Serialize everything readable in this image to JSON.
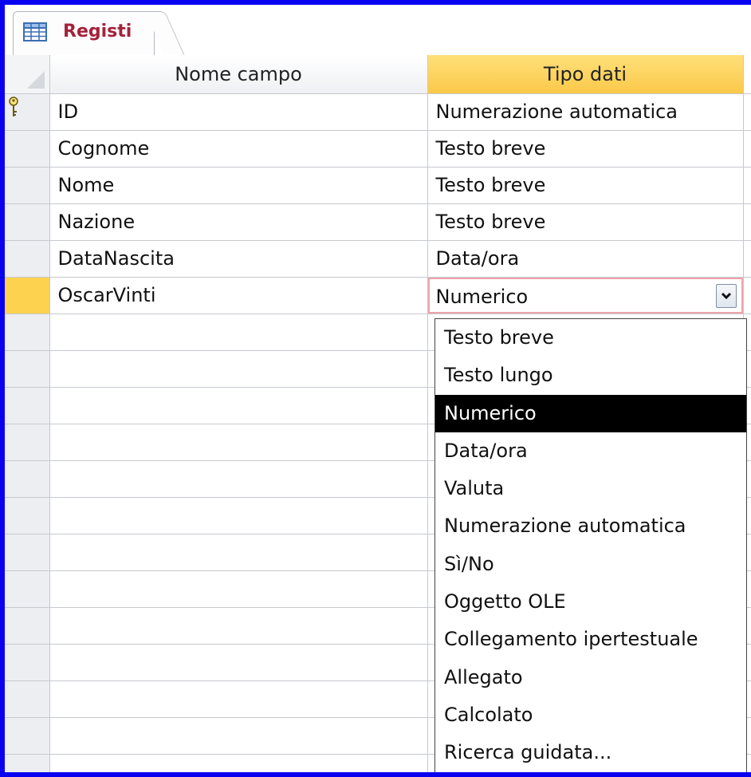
{
  "tab": {
    "label": "Registi",
    "icon": "table-icon"
  },
  "columns": {
    "name": "Nome campo",
    "type": "Tipo dati"
  },
  "fields": [
    {
      "name": "ID",
      "type": "Numerazione automatica",
      "primary_key": true
    },
    {
      "name": "Cognome",
      "type": "Testo breve"
    },
    {
      "name": "Nome",
      "type": "Testo breve"
    },
    {
      "name": "Nazione",
      "type": "Testo breve"
    },
    {
      "name": "DataNascita",
      "type": "Data/ora"
    },
    {
      "name": "OscarVinti",
      "type": "Numerico",
      "editing": true
    }
  ],
  "combo": {
    "value": "Numerico",
    "button_icon": "chevron-down-icon"
  },
  "dropdown": {
    "items": [
      "Testo breve",
      "Testo lungo",
      "Numerico",
      "Data/ora",
      "Valuta",
      "Numerazione automatica",
      "Sì/No",
      "Oggetto OLE",
      "Collegamento ipertestuale",
      "Allegato",
      "Calcolato",
      "Ricerca guidata..."
    ],
    "selected": "Numerico"
  },
  "colors": {
    "frame": "#0a00f0",
    "tab_text": "#a4223a",
    "active_header": "#fbc84a",
    "current_row_selector": "#fcd24f",
    "combo_border": "#f0a3ab"
  }
}
